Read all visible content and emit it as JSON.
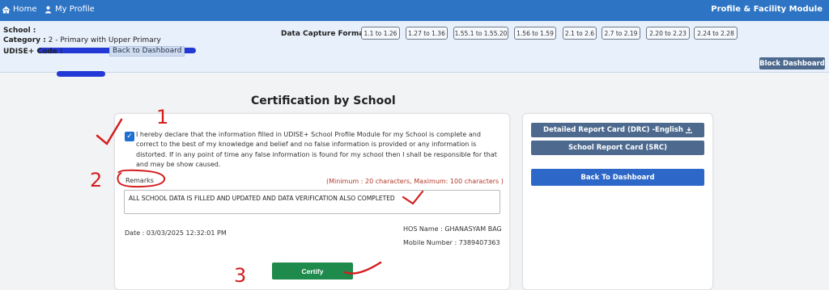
{
  "topbar": {
    "home": "Home",
    "profile": "My Profile",
    "module_title": "Profile & Facility Module"
  },
  "info": {
    "school_label": "School :",
    "category_label": "Category :",
    "category_value": "2 - Primary with Upper Primary",
    "udise_label": "UDISE+ Code :",
    "back_to_dashboard": "Back to Dashboard"
  },
  "data_capture": {
    "label": "Data Capture Format :",
    "formats": [
      "1.1 to 1.26",
      "1.27 to 1.36",
      "1.55.1 to 1.55.20",
      "1.56 to 1.59",
      "2.1 to 2.6",
      "2.7 to 2.19",
      "2.20 to 2.23",
      "2.24 to 2.28"
    ]
  },
  "block_dashboard": "Block Dashboard",
  "certification": {
    "title": "Certification by School",
    "declaration": "I hereby declare that the information filled in UDISE+ School Profile Module for my School is complete and correct to the best of my knowledge and belief and no false information is provided or any information is distorted. If in any point of time any false information is found for my school then I shall be responsible for that and may be show caused.",
    "remarks_label": "Remarks",
    "remarks_hint": "(Minimum : 20 characters, Maximum: 100 characters )",
    "remarks_value": "ALL SCHOOL DATA IS FILLED AND UPDATED AND DATA VERIFICATION ALSO COMPLETED",
    "date": "Date : 03/03/2025 12:32:01 PM",
    "hos_name": "HOS Name : GHANASYAM BAG",
    "mobile": "Mobile Number : 7389407363",
    "certify": "Certify"
  },
  "side": {
    "drc": "Detailed Report Card (DRC) -English",
    "src": "School Report Card (SRC)",
    "back": "Back To Dashboard"
  },
  "annotations": {
    "one": "1",
    "two": "2",
    "three": "3"
  },
  "colors": {
    "topbar": "#2d74c4",
    "slate_button": "#4d6a8e",
    "certify_green": "#1e8a4c",
    "back_blue": "#2d67c7",
    "annotation_red": "#d41e1e"
  }
}
